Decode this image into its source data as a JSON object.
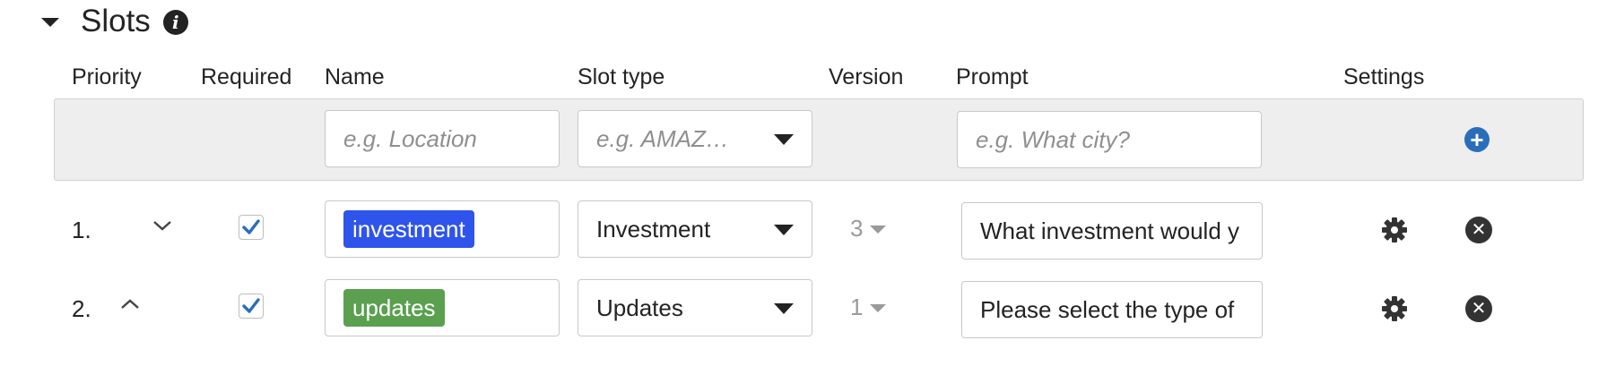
{
  "section": {
    "title": "Slots",
    "info_icon": "info-icon"
  },
  "columns": {
    "priority": "Priority",
    "required": "Required",
    "name": "Name",
    "slot_type": "Slot type",
    "version": "Version",
    "prompt": "Prompt",
    "settings": "Settings"
  },
  "new_slot": {
    "name_placeholder": "e.g. Location",
    "slot_type_placeholder": "e.g. AMAZ…",
    "prompt_placeholder": "e.g. What city?",
    "add_icon": "plus-circle-icon"
  },
  "slots": [
    {
      "priority": "1.",
      "move_icon": "chevron-down-icon",
      "required": true,
      "name": "investment",
      "name_tag_color": "#2f54eb",
      "slot_type": "Investment",
      "version": "3",
      "prompt": "What investment would y"
    },
    {
      "priority": "2.",
      "move_icon": "chevron-up-icon",
      "required": true,
      "name": "updates",
      "name_tag_color": "#5aa04f",
      "slot_type": "Updates",
      "version": "1",
      "prompt": "Please select the type of"
    }
  ],
  "colors": {
    "accent": "#2a6ebb",
    "header_bg": "#eeeeee"
  }
}
